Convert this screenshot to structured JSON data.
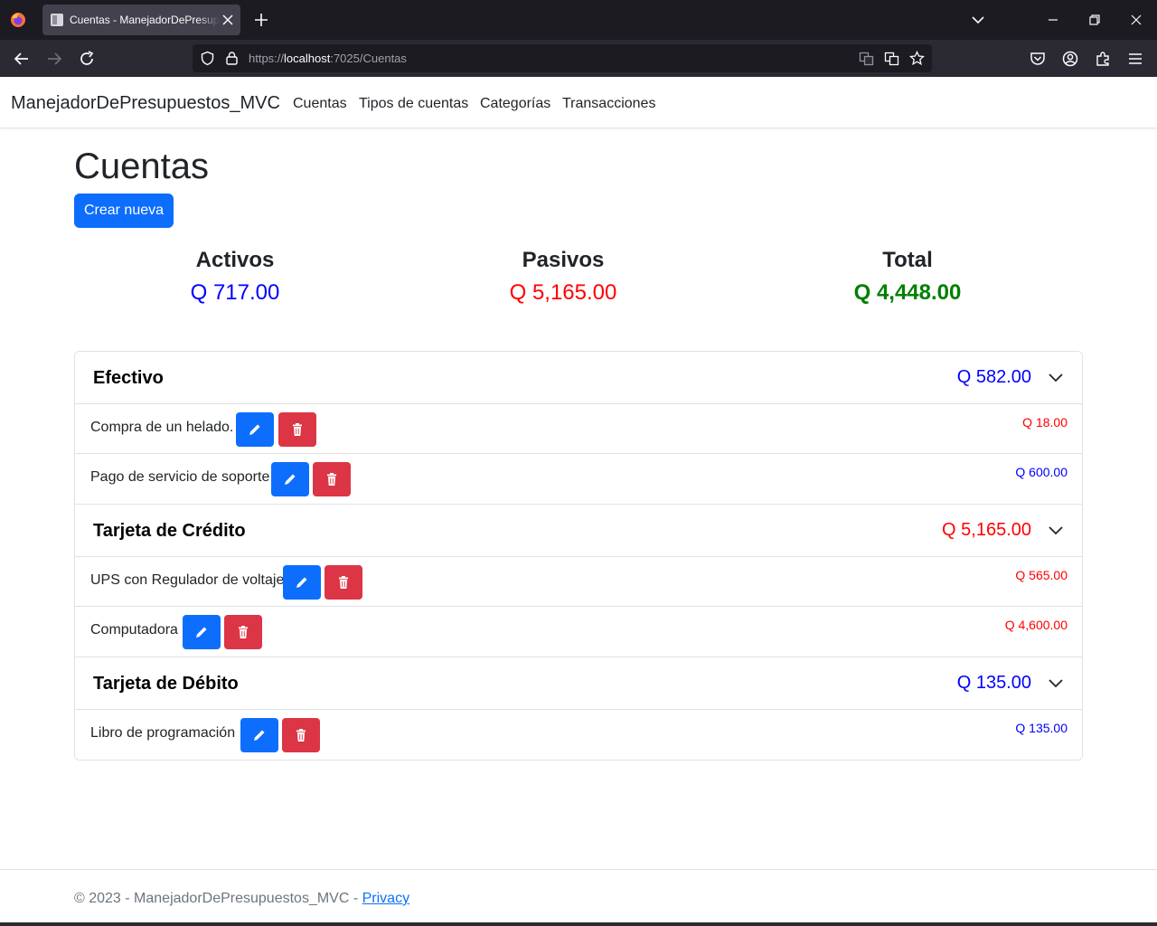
{
  "browser": {
    "tab_title": "Cuentas - ManejadorDePresupuestos_MVC",
    "url_prefix": "https://",
    "url_host": "localhost",
    "url_rest": ":7025/Cuentas"
  },
  "nav": {
    "brand": "ManejadorDePresupuestos_MVC",
    "links": [
      "Cuentas",
      "Tipos de cuentas",
      "Categorías",
      "Transacciones"
    ]
  },
  "page": {
    "title": "Cuentas",
    "create_button": "Crear nueva"
  },
  "summary": {
    "activos_label": "Activos",
    "activos_value": "Q 717.00",
    "pasivos_label": "Pasivos",
    "pasivos_value": "Q 5,165.00",
    "total_label": "Total",
    "total_value": "Q 4,448.00"
  },
  "groups": [
    {
      "title": "Efectivo",
      "total": "Q 582.00",
      "total_color": "#0000ff",
      "items": [
        {
          "name": "Compra de un helado.",
          "amount": "Q 18.00",
          "color": "#ff0000"
        },
        {
          "name": "Pago de servicio de soporte",
          "amount": "Q 600.00",
          "color": "#0000ff"
        }
      ]
    },
    {
      "title": "Tarjeta de Crédito",
      "total": "Q 5,165.00",
      "total_color": "#ff0000",
      "items": [
        {
          "name": "UPS con Regulador de voltaje",
          "amount": "Q 565.00",
          "color": "#ff0000"
        },
        {
          "name": "Computadora",
          "amount": "Q 4,600.00",
          "color": "#ff0000"
        }
      ]
    },
    {
      "title": "Tarjeta de Débito",
      "total": "Q 135.00",
      "total_color": "#0000ff",
      "items": [
        {
          "name": "Libro de programación",
          "amount": "Q 135.00",
          "color": "#0000ff"
        }
      ]
    }
  ],
  "footer": {
    "text": "© 2023 - ManejadorDePresupuestos_MVC - ",
    "link": "Privacy"
  },
  "colors": {
    "primary": "#0d6efd",
    "danger": "#dc3545",
    "activo": "#0000ff",
    "pasivo": "#ff0000",
    "total": "#008000"
  }
}
